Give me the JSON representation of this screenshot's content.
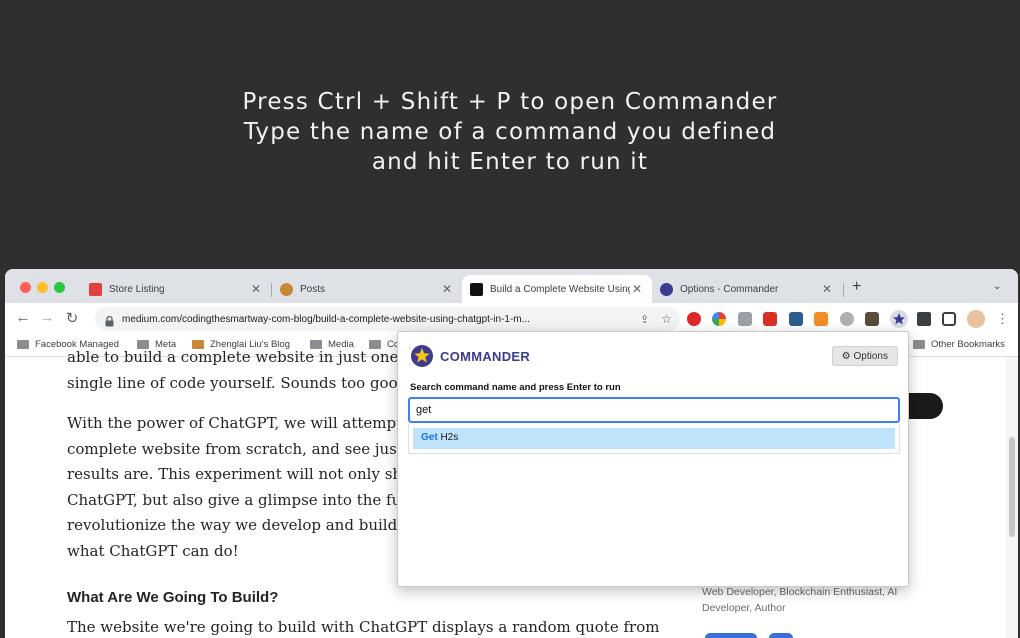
{
  "promo": {
    "lines": [
      "Press Ctrl + Shift + P to open Commander",
      "Type the name of a command you defined",
      "and hit Enter to run it"
    ]
  },
  "browser": {
    "tabs": [
      {
        "title": "Store Listing",
        "favicon_color": "#e0413e"
      },
      {
        "title": "Posts",
        "favicon_color": "#c8883a"
      },
      {
        "title": "Build a Complete Website Using",
        "favicon_color": "#111111"
      },
      {
        "title": "Options - Commander",
        "favicon_color": "#3b3b8f"
      }
    ],
    "new_tab_label": "+",
    "url": "medium.com/codingthesmartway-com-blog/build-a-complete-website-using-chatgpt-in-1-m...",
    "bookmarks": [
      "Facebook Managed",
      "Meta",
      "Zhenglai Liu's Blog",
      "Media",
      "Co",
      "Other Bookmarks"
    ]
  },
  "article": {
    "lines_top": [
      "able to build a complete website in just one",
      "single line of code yourself. Sounds too goo"
    ],
    "paragraph": [
      "With the power of ChatGPT, we will attempt to",
      "complete website from scratch, and see just ho",
      "results are. This experiment will not only show",
      "ChatGPT, but also give a glimpse into the future",
      "revolutionize the way we develop and build web",
      "what ChatGPT can do!"
    ],
    "heading": "What Are We Going To Build?",
    "last_line": "The website we're going to build with ChatGPT displays a random quote from",
    "author_bio": [
      "Web Developer, Blockchain Enthusiast, AI",
      "Developer, Author"
    ]
  },
  "commander": {
    "brand": "COMMANDER",
    "options_label": "Options",
    "hint": "Search command name and press Enter to run",
    "query": "get",
    "results": [
      {
        "match": "Get",
        "rest": " H2s"
      }
    ],
    "accent": "#3b82f6",
    "highlight": "#bfe3fb"
  }
}
